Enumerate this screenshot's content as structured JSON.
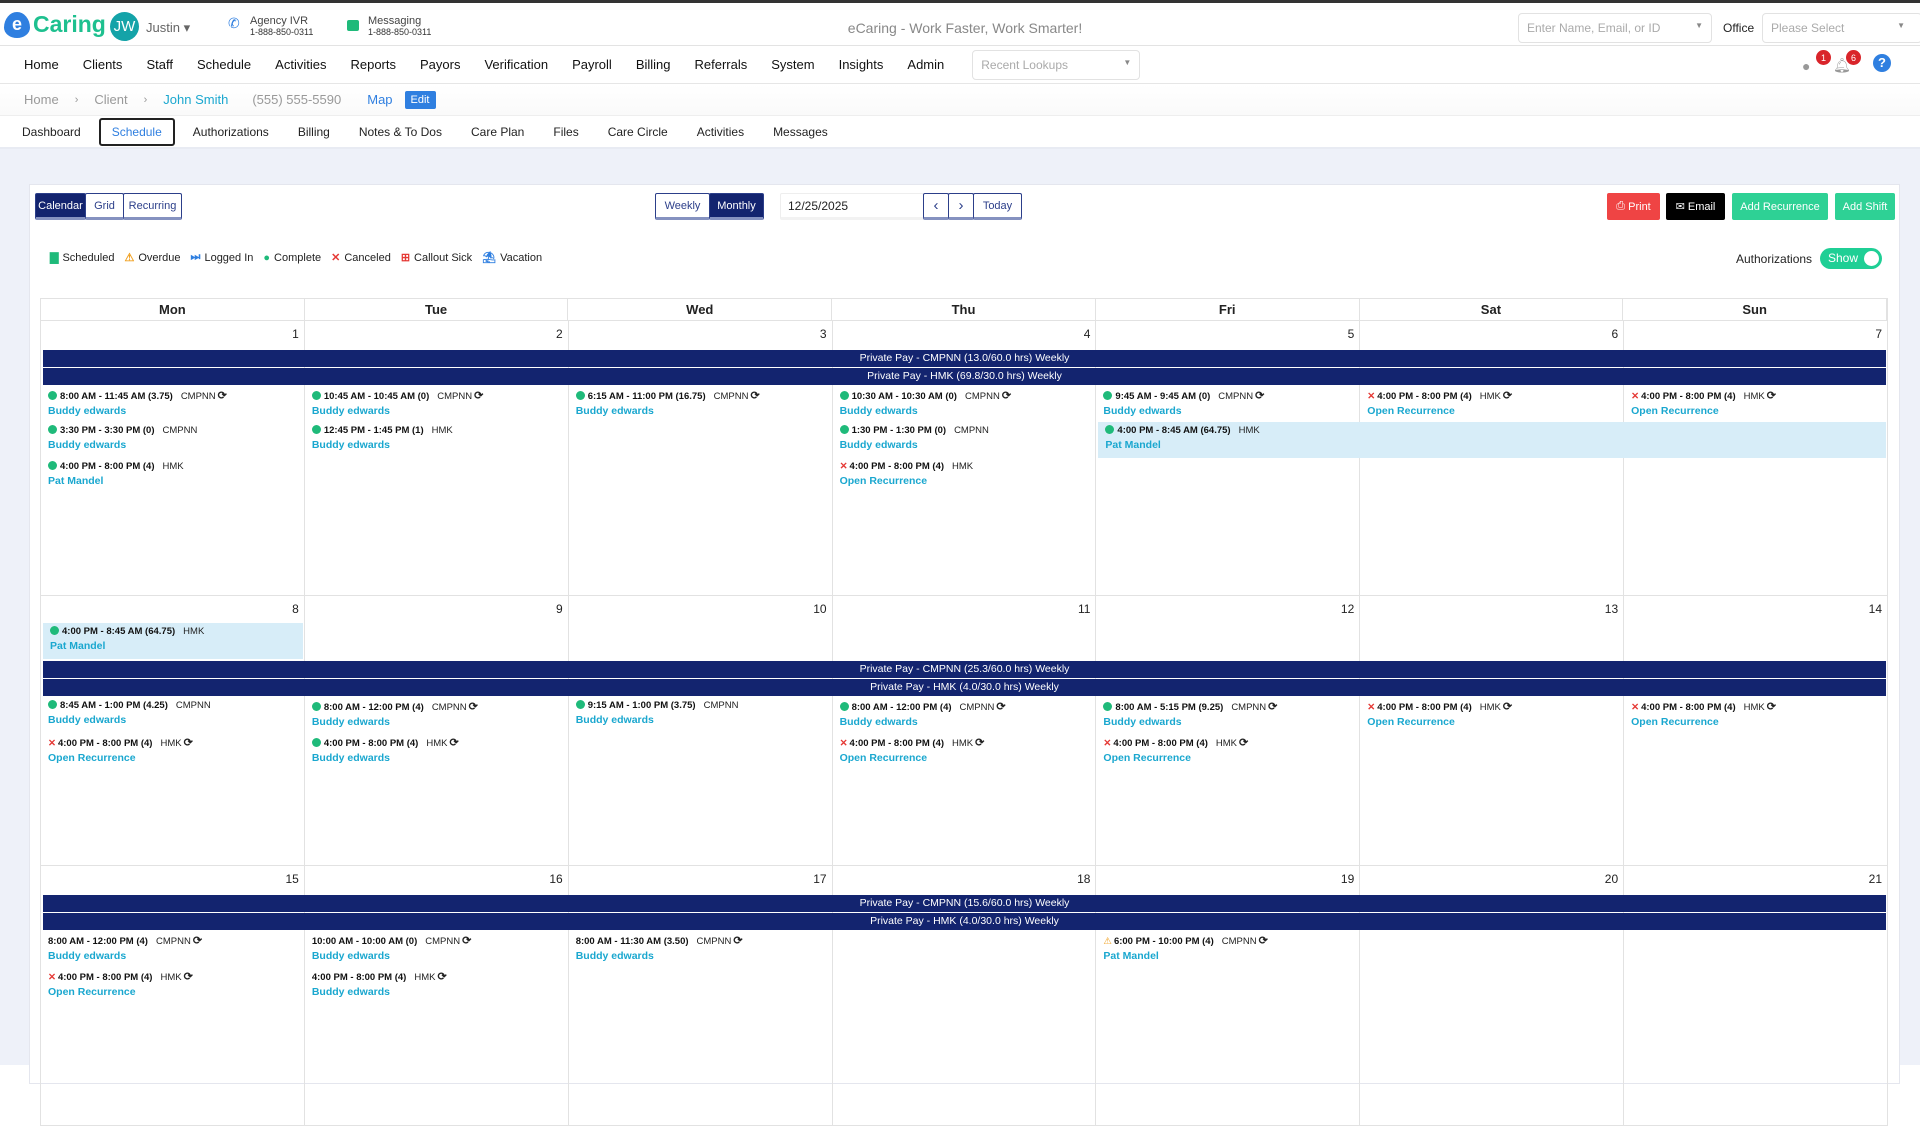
{
  "topbar": {
    "logo": "Caring",
    "avatar_initials": "JW",
    "user": "Justin",
    "agency_ivr": {
      "label": "Agency IVR",
      "phone": "1-888-850-0311"
    },
    "messaging": {
      "label": "Messaging",
      "phone": "1-888-850-0311"
    },
    "tagline": "eCaring - Work Faster, Work Smarter!",
    "search_placeholder": "Enter Name, Email, or ID",
    "office_label": "Office",
    "office_placeholder": "Please Select"
  },
  "nav": {
    "items": [
      "Home",
      "Clients",
      "Staff",
      "Schedule",
      "Activities",
      "Reports",
      "Payors",
      "Verification",
      "Payroll",
      "Billing",
      "Referrals",
      "System",
      "Insights",
      "Admin"
    ],
    "recent_placeholder": "Recent Lookups",
    "chat_badge": "1",
    "bell_badge": "6"
  },
  "breadcrumb": {
    "home": "Home",
    "client": "Client",
    "name": "John Smith",
    "phone": "(555) 555-5590",
    "map": "Map",
    "edit": "Edit"
  },
  "subtabs": {
    "items": [
      "Dashboard",
      "Schedule",
      "Authorizations",
      "Billing",
      "Notes & To Dos",
      "Care Plan",
      "Files",
      "Care Circle",
      "Activities",
      "Messages"
    ],
    "active": 1
  },
  "toolbar": {
    "views": [
      "Calendar",
      "Grid",
      "Recurring"
    ],
    "ranges": [
      "Weekly",
      "Monthly"
    ],
    "date": "12/25/2025",
    "prev": "‹",
    "next": "›",
    "today": "Today",
    "print": "Print",
    "email": "Email",
    "add_recurrence": "Add Recurrence",
    "add_shift": "Add Shift"
  },
  "legend": [
    "Scheduled",
    "Overdue",
    "Logged In",
    "Complete",
    "Canceled",
    "Callout Sick",
    "Vacation"
  ],
  "authorizations": {
    "label": "Authorizations",
    "toggle": "Show",
    "on": true
  },
  "colors": {
    "navy": "#13246f",
    "teal": "#1fcf95",
    "link": "#1aa7cf",
    "red": "#e53935",
    "complete": "#1fba7a"
  },
  "calendar": {
    "weekdays": [
      "Mon",
      "Tue",
      "Wed",
      "Thu",
      "Fri",
      "Sat",
      "Sun"
    ],
    "weeks": [
      {
        "days": [
          "1",
          "2",
          "3",
          "4",
          "5",
          "6",
          "7"
        ],
        "top_events": [],
        "bars": [
          "Private Pay - CMPNN (13.0/60.0 hrs) Weekly",
          "Private Pay - HMK (69.8/30.0 hrs) Weekly"
        ],
        "events": [
          {
            "col": 1,
            "row": 1,
            "span": 1,
            "status": "complete",
            "time": "8:00 AM - 11:45 AM (3.75)",
            "payor": "CMPNN",
            "recurring": true,
            "name": "Buddy edwards"
          },
          {
            "col": 1,
            "row": 2,
            "span": 1,
            "status": "complete",
            "time": "3:30 PM - 3:30 PM (0)",
            "payor": "CMPNN",
            "recurring": false,
            "name": "Buddy edwards"
          },
          {
            "col": 1,
            "row": 3,
            "span": 1,
            "status": "complete",
            "time": "4:00 PM - 8:00 PM (4)",
            "payor": "HMK",
            "recurring": false,
            "name": "Pat Mandel"
          },
          {
            "col": 2,
            "row": 1,
            "span": 1,
            "status": "complete",
            "time": "10:45 AM - 10:45 AM (0)",
            "payor": "CMPNN",
            "recurring": true,
            "name": "Buddy edwards"
          },
          {
            "col": 2,
            "row": 2,
            "span": 1,
            "status": "complete",
            "time": "12:45 PM - 1:45 PM (1)",
            "payor": "HMK",
            "recurring": false,
            "name": "Buddy edwards"
          },
          {
            "col": 3,
            "row": 1,
            "span": 1,
            "status": "complete",
            "time": "6:15 AM - 11:00 PM (16.75)",
            "payor": "CMPNN",
            "recurring": true,
            "name": "Buddy edwards"
          },
          {
            "col": 4,
            "row": 1,
            "span": 1,
            "status": "complete",
            "time": "10:30 AM - 10:30 AM (0)",
            "payor": "CMPNN",
            "recurring": true,
            "name": "Buddy edwards"
          },
          {
            "col": 4,
            "row": 2,
            "span": 1,
            "status": "complete",
            "time": "1:30 PM - 1:30 PM (0)",
            "payor": "CMPNN",
            "recurring": false,
            "name": "Buddy edwards"
          },
          {
            "col": 4,
            "row": 3,
            "span": 1,
            "status": "canceled",
            "time": "4:00 PM - 8:00 PM (4)",
            "payor": "HMK",
            "recurring": false,
            "name": "Open Recurrence"
          },
          {
            "col": 5,
            "row": 1,
            "span": 1,
            "status": "complete",
            "time": "9:45 AM - 9:45 AM (0)",
            "payor": "CMPNN",
            "recurring": true,
            "name": "Buddy edwards"
          },
          {
            "col": 5,
            "row": 2,
            "span": 3,
            "status": "complete",
            "time": "4:00 PM - 8:45 AM (64.75)",
            "payor": "HMK",
            "recurring": false,
            "name": "Pat Mandel"
          },
          {
            "col": 6,
            "row": 1,
            "span": 1,
            "status": "canceled",
            "time": "4:00 PM - 8:00 PM (4)",
            "payor": "HMK",
            "recurring": true,
            "name": "Open Recurrence"
          },
          {
            "col": 7,
            "row": 1,
            "span": 1,
            "status": "canceled",
            "time": "4:00 PM - 8:00 PM (4)",
            "payor": "HMK",
            "recurring": true,
            "name": "Open Recurrence"
          }
        ]
      },
      {
        "days": [
          "8",
          "9",
          "10",
          "11",
          "12",
          "13",
          "14"
        ],
        "top_events": [
          {
            "col": 1,
            "span": 1,
            "status": "complete",
            "time": "4:00 PM - 8:45 AM (64.75)",
            "payor": "HMK",
            "recurring": false,
            "name": "Pat Mandel"
          }
        ],
        "bars": [
          "Private Pay - CMPNN (25.3/60.0 hrs) Weekly",
          "Private Pay - HMK (4.0/30.0 hrs) Weekly"
        ],
        "events": [
          {
            "col": 1,
            "row": 1,
            "span": 1,
            "status": "complete",
            "time": "8:45 AM - 1:00 PM (4.25)",
            "payor": "CMPNN",
            "recurring": false,
            "name": "Buddy edwards"
          },
          {
            "col": 1,
            "row": 2,
            "span": 1,
            "status": "canceled",
            "time": "4:00 PM - 8:00 PM (4)",
            "payor": "HMK",
            "recurring": true,
            "name": "Open Recurrence"
          },
          {
            "col": 2,
            "row": 1,
            "span": 1,
            "status": "complete",
            "time": "8:00 AM - 12:00 PM (4)",
            "payor": "CMPNN",
            "recurring": true,
            "name": "Buddy edwards"
          },
          {
            "col": 2,
            "row": 2,
            "span": 1,
            "status": "complete",
            "time": "4:00 PM - 8:00 PM (4)",
            "payor": "HMK",
            "recurring": true,
            "name": "Buddy edwards"
          },
          {
            "col": 3,
            "row": 1,
            "span": 1,
            "status": "complete",
            "time": "9:15 AM - 1:00 PM (3.75)",
            "payor": "CMPNN",
            "recurring": false,
            "name": "Buddy edwards"
          },
          {
            "col": 4,
            "row": 1,
            "span": 1,
            "status": "complete",
            "time": "8:00 AM - 12:00 PM (4)",
            "payor": "CMPNN",
            "recurring": true,
            "name": "Buddy edwards"
          },
          {
            "col": 4,
            "row": 2,
            "span": 1,
            "status": "canceled",
            "time": "4:00 PM - 8:00 PM (4)",
            "payor": "HMK",
            "recurring": true,
            "name": "Open Recurrence"
          },
          {
            "col": 5,
            "row": 1,
            "span": 1,
            "status": "complete",
            "time": "8:00 AM - 5:15 PM (9.25)",
            "payor": "CMPNN",
            "recurring": true,
            "name": "Buddy edwards"
          },
          {
            "col": 5,
            "row": 2,
            "span": 1,
            "status": "canceled",
            "time": "4:00 PM - 8:00 PM (4)",
            "payor": "HMK",
            "recurring": true,
            "name": "Open Recurrence"
          },
          {
            "col": 6,
            "row": 1,
            "span": 1,
            "status": "canceled",
            "time": "4:00 PM - 8:00 PM (4)",
            "payor": "HMK",
            "recurring": true,
            "name": "Open Recurrence"
          },
          {
            "col": 7,
            "row": 1,
            "span": 1,
            "status": "canceled",
            "time": "4:00 PM - 8:00 PM (4)",
            "payor": "HMK",
            "recurring": true,
            "name": "Open Recurrence"
          }
        ]
      },
      {
        "days": [
          "15",
          "16",
          "17",
          "18",
          "19",
          "20",
          "21"
        ],
        "top_events": [],
        "bars": [
          "Private Pay - CMPNN (15.6/60.0 hrs) Weekly",
          "Private Pay - HMK (4.0/30.0 hrs) Weekly"
        ],
        "events": [
          {
            "col": 1,
            "row": 1,
            "span": 1,
            "status": "none",
            "time": "8:00 AM - 12:00 PM (4)",
            "payor": "CMPNN",
            "recurring": true,
            "name": "Buddy edwards"
          },
          {
            "col": 1,
            "row": 2,
            "span": 1,
            "status": "canceled",
            "time": "4:00 PM - 8:00 PM (4)",
            "payor": "HMK",
            "recurring": true,
            "name": "Open Recurrence"
          },
          {
            "col": 2,
            "row": 1,
            "span": 1,
            "status": "none",
            "time": "10:00 AM - 10:00 AM (0)",
            "payor": "CMPNN",
            "recurring": true,
            "name": "Buddy edwards"
          },
          {
            "col": 2,
            "row": 2,
            "span": 1,
            "status": "none",
            "time": "4:00 PM - 8:00 PM (4)",
            "payor": "HMK",
            "recurring": true,
            "name": "Buddy edwards"
          },
          {
            "col": 3,
            "row": 1,
            "span": 1,
            "status": "none",
            "time": "8:00 AM - 11:30 AM (3.50)",
            "payor": "CMPNN",
            "recurring": true,
            "name": "Buddy edwards"
          },
          {
            "col": 5,
            "row": 1,
            "span": 1,
            "status": "overdue",
            "time": "6:00 PM - 10:00 PM (4)",
            "payor": "CMPNN",
            "recurring": true,
            "name": "Pat Mandel"
          }
        ]
      }
    ]
  }
}
